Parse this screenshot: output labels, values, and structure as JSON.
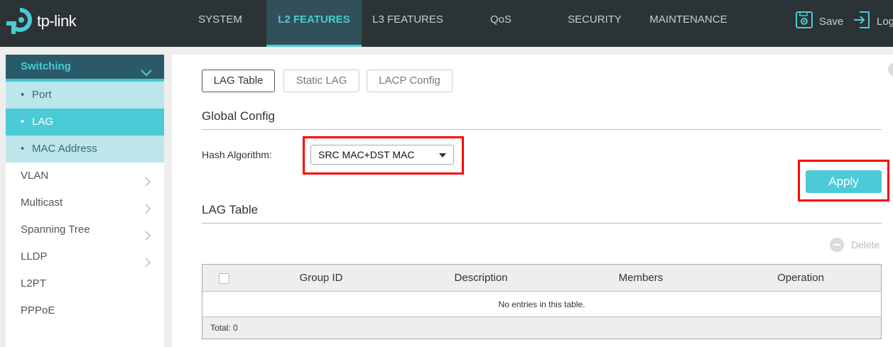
{
  "brand": {
    "logo_text": "tp-link"
  },
  "topnav": {
    "items": [
      {
        "label": "SYSTEM"
      },
      {
        "label": "L2 FEATURES"
      },
      {
        "label": "L3 FEATURES"
      },
      {
        "label": "QoS"
      },
      {
        "label": "SECURITY"
      },
      {
        "label": "MAINTENANCE"
      }
    ],
    "active": "L2 FEATURES",
    "save_label": "Save",
    "logout_label": "Log"
  },
  "sidebar": {
    "section": "Switching",
    "subitems": [
      {
        "label": "Port"
      },
      {
        "label": "LAG"
      },
      {
        "label": "MAC Address"
      }
    ],
    "active_subitem": "LAG",
    "items": [
      {
        "label": "VLAN",
        "has_arrow": true
      },
      {
        "label": "Multicast",
        "has_arrow": true
      },
      {
        "label": "Spanning Tree",
        "has_arrow": true
      },
      {
        "label": "LLDP",
        "has_arrow": true
      },
      {
        "label": "L2PT",
        "has_arrow": false
      },
      {
        "label": "PPPoE",
        "has_arrow": false
      }
    ]
  },
  "main": {
    "tabs": [
      {
        "label": "LAG Table"
      },
      {
        "label": "Static LAG"
      },
      {
        "label": "LACP Config"
      }
    ],
    "active_tab": "LAG Table",
    "global_config": {
      "title": "Global Config",
      "hash_label": "Hash Algorithm:",
      "hash_value": "SRC MAC+DST MAC"
    },
    "apply_label": "Apply",
    "lag_table": {
      "title": "LAG Table",
      "delete_label": "Delete",
      "columns": [
        "Group ID",
        "Description",
        "Members",
        "Operation"
      ],
      "empty_text": "No entries in this table.",
      "total_text": "Total: 0"
    }
  },
  "colors": {
    "accent": "#4acbd6",
    "topbar_bg": "#2b3336",
    "highlight_box": "#ff0000"
  }
}
